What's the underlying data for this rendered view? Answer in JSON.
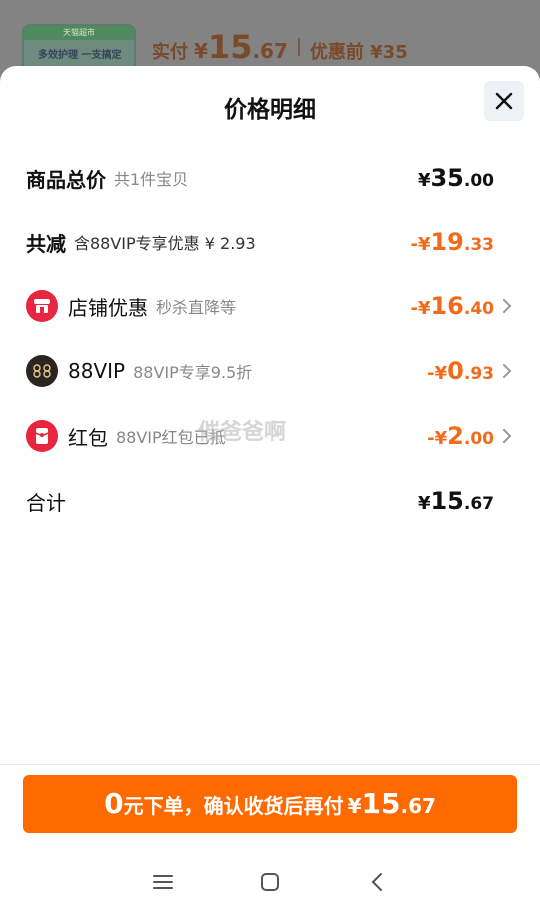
{
  "background": {
    "thumb_top": "天猫超市",
    "thumb_text": "多效护理 一支搞定",
    "paid_label": "实付",
    "paid_yen": "¥",
    "paid_int": "15",
    "paid_dec": ".67",
    "orig_label": "优惠前 ¥35"
  },
  "sheet": {
    "title": "价格明细",
    "close_icon": "close-icon"
  },
  "rows": {
    "total": {
      "label": "商品总价",
      "sub": "共1件宝贝",
      "sign": "¥",
      "int": "35",
      "dec": ".00"
    },
    "reduce": {
      "label": "共减",
      "sub": "含88VIP专享优惠 ¥ 2.93",
      "sign": "-¥",
      "int": "19",
      "dec": ".33"
    },
    "shop": {
      "label": "店铺优惠",
      "sub": "秒杀直降等",
      "sign": "-¥",
      "int": "16",
      "dec": ".40",
      "icon": "shop-icon"
    },
    "vip": {
      "label": "88VIP",
      "sub": "88VIP专享9.5折",
      "sign": "-¥",
      "int": "0",
      "dec": ".93",
      "icon": "vip-88-icon"
    },
    "redpack": {
      "label": "红包",
      "sub": "88VIP红包已抵",
      "sign": "-¥",
      "int": "2",
      "dec": ".00",
      "icon": "red-packet-icon"
    },
    "sum": {
      "label": "合计",
      "sign": "¥",
      "int": "15",
      "dec": ".67"
    }
  },
  "watermark": "催爸爸啊",
  "cta": {
    "zero": "0",
    "text": "元下单，确认收货后再付",
    "yen": "¥",
    "int": "15",
    "dec": ".67"
  },
  "colors": {
    "accent": "#ff6a00",
    "discount": "#f26a1b"
  }
}
